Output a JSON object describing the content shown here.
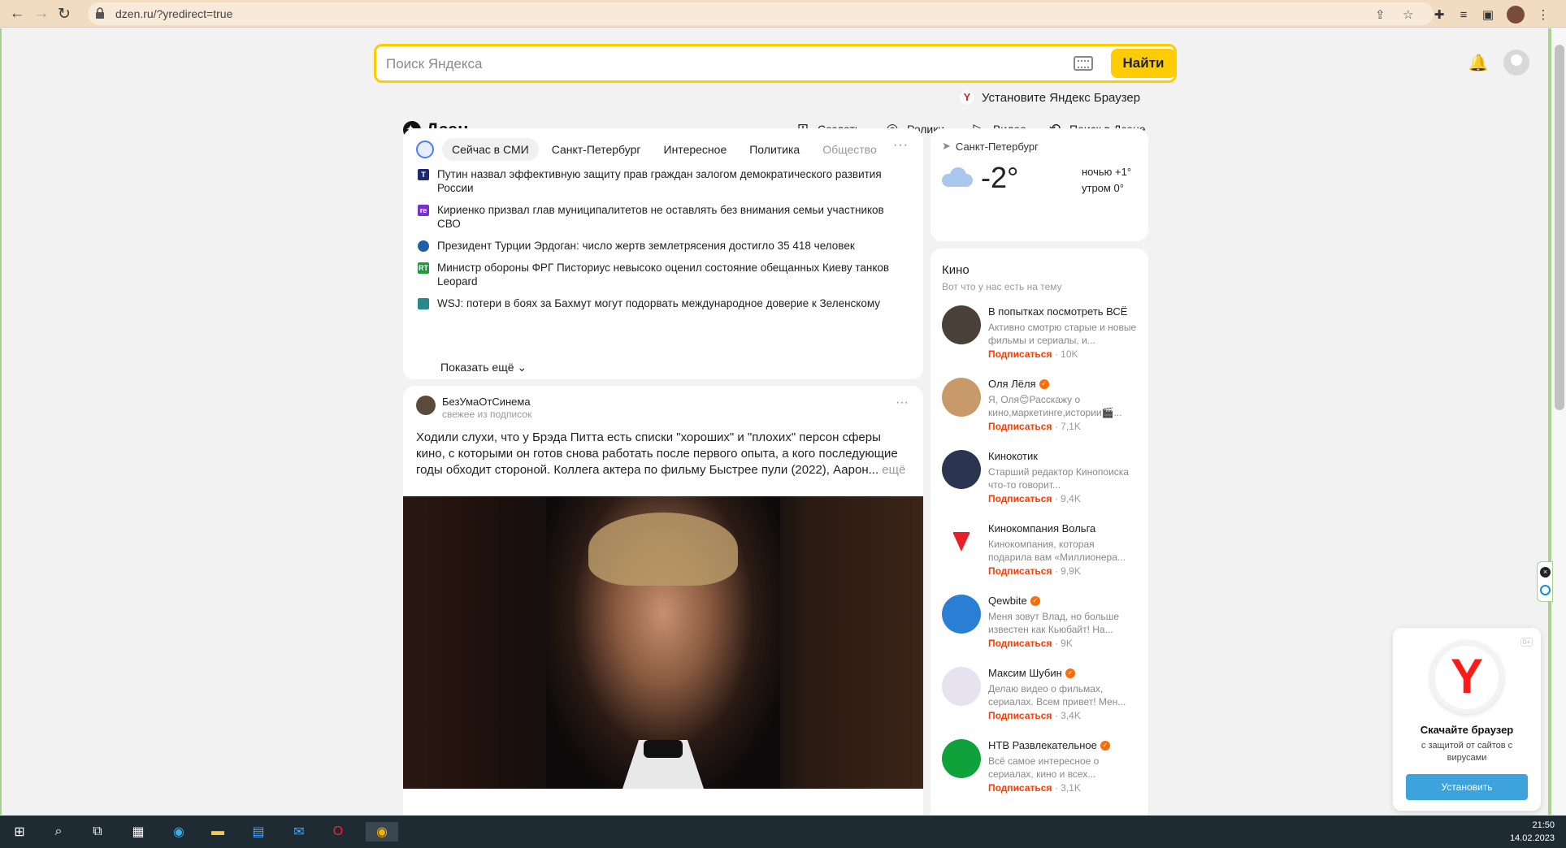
{
  "browser": {
    "url": "dzen.ru/?yredirect=true"
  },
  "search": {
    "placeholder": "Поиск Яндекса",
    "button": "Найти"
  },
  "install_prompt": "Установите Яндекс Браузер",
  "header": {
    "logo": "Дзен",
    "nav": [
      "Создать",
      "Ролики",
      "Видео",
      "Поиск в Дзене"
    ]
  },
  "news": {
    "tabs": [
      "Сейчас в СМИ",
      "Санкт-Петербург",
      "Интересное",
      "Политика",
      "Общество"
    ],
    "items": [
      {
        "text": "Путин назвал эффективную защиту прав граждан залогом демократического развития России",
        "source_color": "#1d2a6e"
      },
      {
        "text": "Кириенко призвал глав муниципалитетов не оставлять без внимания семьи участников СВО",
        "source_color": "#7b2fd0"
      },
      {
        "text": "Президент Турции Эрдоган: число жертв землетрясения достигло 35 418 человек",
        "source_color": "#1f5fa8"
      },
      {
        "text": "Министр обороны ФРГ Писториус невысоко оценил состояние обещанных Киеву танков Leopard",
        "source_color": "#1a9c3a"
      },
      {
        "text": "WSJ: потери в боях за Бахмут могут подорвать международное доверие к Зеленскому",
        "source_color": "#2a8a8a"
      }
    ],
    "show_more": "Показать ещё"
  },
  "post": {
    "author": "БезУмаОтСинема",
    "subtitle": "свежее из подписок",
    "text": "Ходили слухи, что у Брэда Питта есть списки \"хороших\" и \"плохих\" персон сферы кино, с которыми он готов снова работать после первого опыта, а кого последующие годы обходит стороной. Коллега актера по фильму Быстрее пули (2022), Аарон...",
    "more": "ещё"
  },
  "weather": {
    "city": "Санкт-Петербург",
    "temp": "-2°",
    "night": "ночью +1°",
    "morning": "утром 0°"
  },
  "kino": {
    "title": "Кино",
    "subtitle": "Вот что у нас есть на тему",
    "subscribe_label": "Подписаться",
    "channels": [
      {
        "name": "В попытках посмотреть ВСЁ",
        "verified": false,
        "desc": "Активно смотрю старые и новые фильмы и сериалы, и...",
        "subs": "· 10K",
        "color": "#4a4038"
      },
      {
        "name": "Оля Лёля",
        "verified": true,
        "desc": "Я, Оля😊Расскажу о кино,маркетинге,истории🎬...",
        "subs": "· 7,1K",
        "color": "#c89a6a"
      },
      {
        "name": "Кинокотик",
        "verified": false,
        "desc": "Старший редактор Кинопоиска что-то говорит...",
        "subs": "· 9,4K",
        "color": "#2b3550"
      },
      {
        "name": "Кинокомпания Вольга",
        "verified": false,
        "desc": "Кинокомпания, которая подарила вам «Миллионера...",
        "subs": "· 9,9K",
        "color": "#ffffff"
      },
      {
        "name": "Qewbite",
        "verified": true,
        "desc": "Меня зовут Влад, но больше известен как Кьюбайт! На...",
        "subs": "· 9K",
        "color": "#2a7fd4"
      },
      {
        "name": "Максим Шубин",
        "verified": true,
        "desc": "Делаю видео о фильмах, сериалах. Всем привет! Мен...",
        "subs": "· 3,4K",
        "color": "#e8e2f0"
      },
      {
        "name": "НТВ Развлекательное",
        "verified": true,
        "desc": "Всё самое интересное о сериалах, кино и всех...",
        "subs": "· 3,1K",
        "color": "#0fa23a"
      }
    ]
  },
  "download_popup": {
    "age": "0+",
    "title": "Скачайте браузер",
    "desc": "с защитой от сайтов с вирусами",
    "button": "Установить"
  },
  "taskbar": {
    "time": "21:50",
    "date": "14.02.2023"
  }
}
